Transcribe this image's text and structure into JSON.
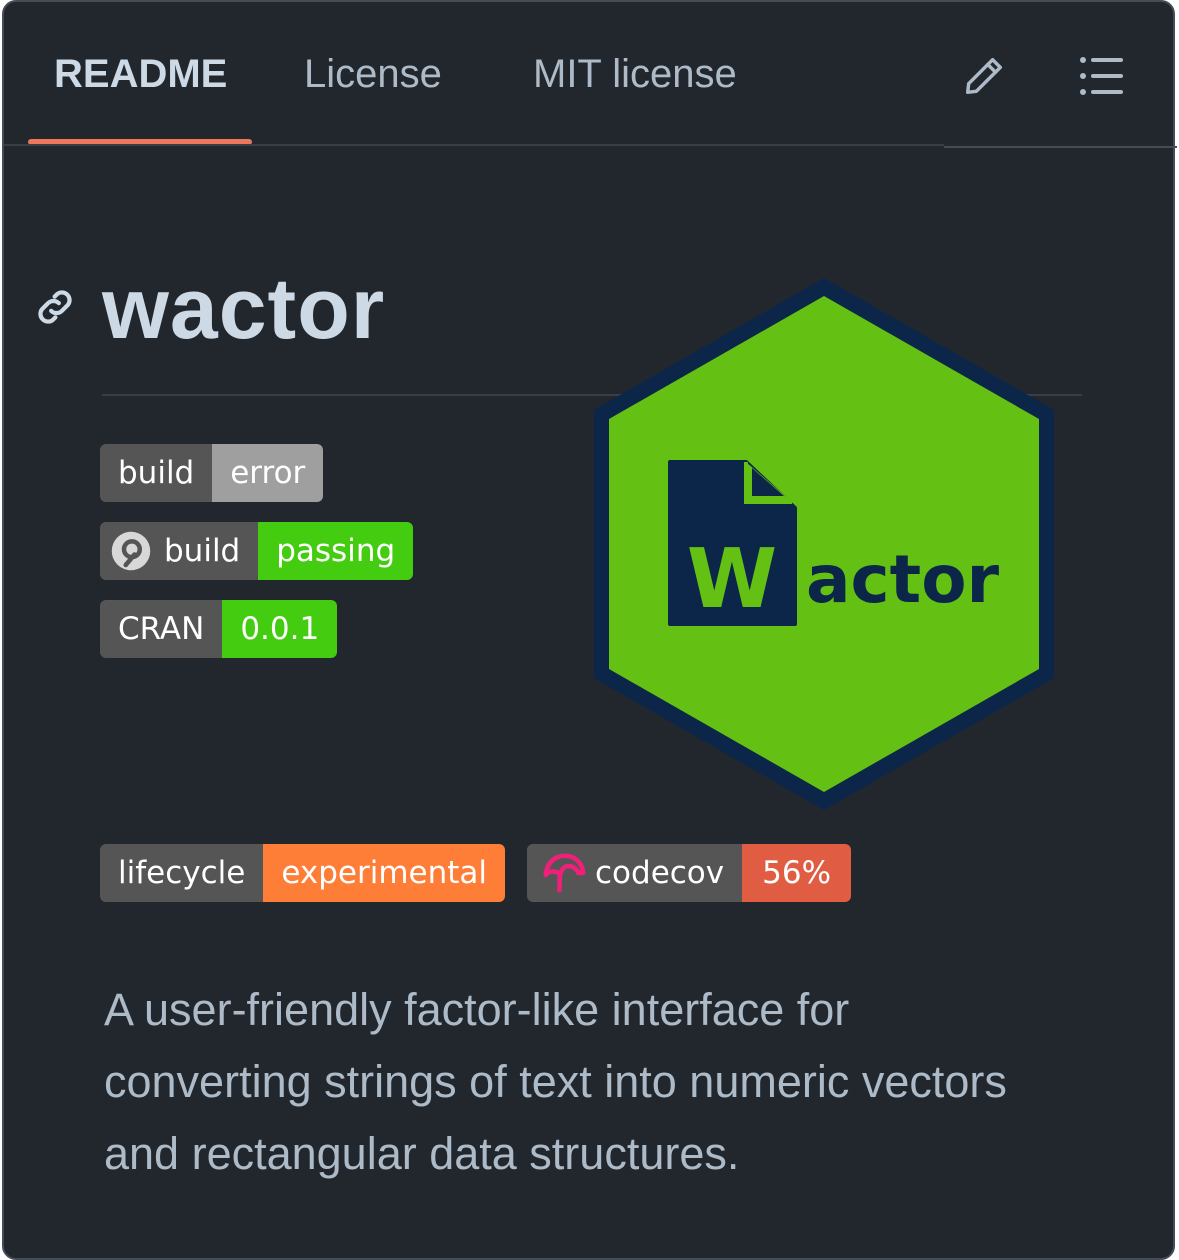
{
  "tabs": [
    {
      "label": "README",
      "active": true
    },
    {
      "label": "License",
      "active": false
    },
    {
      "label": "MIT license",
      "active": false
    }
  ],
  "toolbar": {
    "edit_icon": "pencil-icon",
    "outline_icon": "list-icon"
  },
  "readme": {
    "title": "wactor",
    "anchor_icon": "link-icon",
    "badges": [
      {
        "label": "build",
        "message": "error",
        "color": "#9f9f9f"
      },
      {
        "label": "build",
        "message": "passing",
        "color": "#4c1",
        "icon": "appveyor-icon"
      },
      {
        "label": "CRAN",
        "message": "0.0.1",
        "color": "#4c1"
      },
      {
        "label": "lifecycle",
        "message": "experimental",
        "color": "#fe7d37"
      },
      {
        "label": "codecov",
        "message": "56%",
        "color": "#e05d44",
        "icon": "codecov-icon"
      }
    ],
    "logo": {
      "letter": "W",
      "text": "actor",
      "fill": "#64c114",
      "border": "#0b2648"
    },
    "description": "A user-friendly factor-like interface for converting strings of text into numeric vectors and rectangular data structures."
  },
  "colors": {
    "background": "#22272e",
    "accent": "#ec775c",
    "text": "#adbac7"
  }
}
